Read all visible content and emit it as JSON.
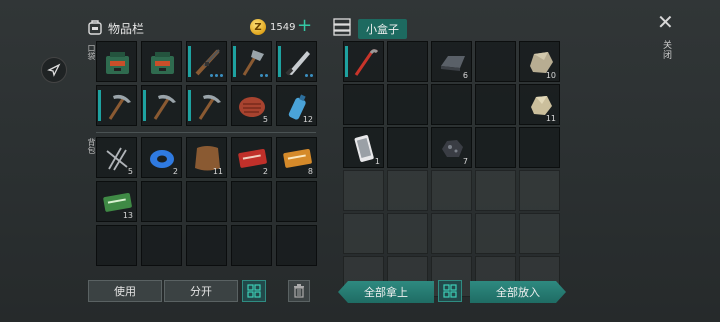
{
  "inventory": {
    "title": "物品栏",
    "coins": "1549",
    "coin_symbol": "Z",
    "plus": "+"
  },
  "labels": {
    "pocket": "口袋",
    "backpack": "背包"
  },
  "box": {
    "title": "小盒子"
  },
  "close": {
    "symbol": "✕",
    "label": "关闭"
  },
  "buttons": {
    "use": "使用",
    "split": "分开",
    "take_all": "全部拿上",
    "put_all": "全部放入"
  },
  "pocket_slots": [
    {
      "icon": "backpack-icon",
      "count": "",
      "dots": 0,
      "durability": false
    },
    {
      "icon": "backpack-icon",
      "count": "",
      "dots": 0,
      "durability": false
    },
    {
      "icon": "rifle-icon",
      "count": "",
      "dots": 3,
      "durability": true
    },
    {
      "icon": "axe-icon",
      "count": "",
      "dots": 2,
      "durability": true
    },
    {
      "icon": "machete-icon",
      "count": "",
      "dots": 2,
      "durability": true
    },
    {
      "icon": "pickaxe-icon",
      "count": "",
      "dots": 0,
      "durability": true
    },
    {
      "icon": "pickaxe-icon",
      "count": "",
      "dots": 0,
      "durability": true
    },
    {
      "icon": "pickaxe-icon",
      "count": "",
      "dots": 0,
      "durability": true
    },
    {
      "icon": "steak-icon",
      "count": "5",
      "dots": 0,
      "durability": false
    },
    {
      "icon": "water-bottle-icon",
      "count": "12",
      "dots": 0,
      "durability": false
    }
  ],
  "backpack_slots": [
    {
      "icon": "nails-icon",
      "count": "5"
    },
    {
      "icon": "duct-tape-icon",
      "count": "2"
    },
    {
      "icon": "leather-icon",
      "count": "11"
    },
    {
      "icon": "coupon-red-icon",
      "count": "2"
    },
    {
      "icon": "coupon-orange-icon",
      "count": "8"
    },
    {
      "icon": "coupon-green-icon",
      "count": "13"
    },
    {
      "icon": "",
      "count": ""
    },
    {
      "icon": "",
      "count": ""
    },
    {
      "icon": "",
      "count": ""
    },
    {
      "icon": "",
      "count": ""
    },
    {
      "icon": "",
      "count": ""
    },
    {
      "icon": "",
      "count": ""
    },
    {
      "icon": "",
      "count": ""
    },
    {
      "icon": "",
      "count": ""
    },
    {
      "icon": "",
      "count": ""
    }
  ],
  "box_slots": [
    {
      "icon": "crowbar-icon",
      "count": "",
      "durability": true
    },
    {
      "icon": "",
      "count": ""
    },
    {
      "icon": "iron-ingot-icon",
      "count": "6"
    },
    {
      "icon": "",
      "count": ""
    },
    {
      "icon": "stone-icon",
      "count": "10"
    },
    {
      "icon": "",
      "count": ""
    },
    {
      "icon": "",
      "count": ""
    },
    {
      "icon": "",
      "count": ""
    },
    {
      "icon": "",
      "count": ""
    },
    {
      "icon": "limestone-icon",
      "count": "11"
    },
    {
      "icon": "smartphone-icon",
      "count": "1"
    },
    {
      "icon": "",
      "count": ""
    },
    {
      "icon": "iron-ore-icon",
      "count": "7"
    },
    {
      "icon": "",
      "count": ""
    },
    {
      "icon": "",
      "count": ""
    },
    {
      "icon": "",
      "count": ""
    },
    {
      "icon": "",
      "count": ""
    },
    {
      "icon": "",
      "count": ""
    },
    {
      "icon": "",
      "count": ""
    },
    {
      "icon": "",
      "count": ""
    },
    {
      "icon": "",
      "count": ""
    },
    {
      "icon": "",
      "count": ""
    },
    {
      "icon": "",
      "count": ""
    },
    {
      "icon": "",
      "count": ""
    },
    {
      "icon": "",
      "count": ""
    },
    {
      "icon": "",
      "count": ""
    },
    {
      "icon": "",
      "count": ""
    },
    {
      "icon": "",
      "count": ""
    },
    {
      "icon": "",
      "count": ""
    },
    {
      "icon": "",
      "count": ""
    }
  ],
  "colors": {
    "accent": "#2e8a80",
    "durability": "#1ea2a0",
    "coin": "#e0a51c"
  }
}
